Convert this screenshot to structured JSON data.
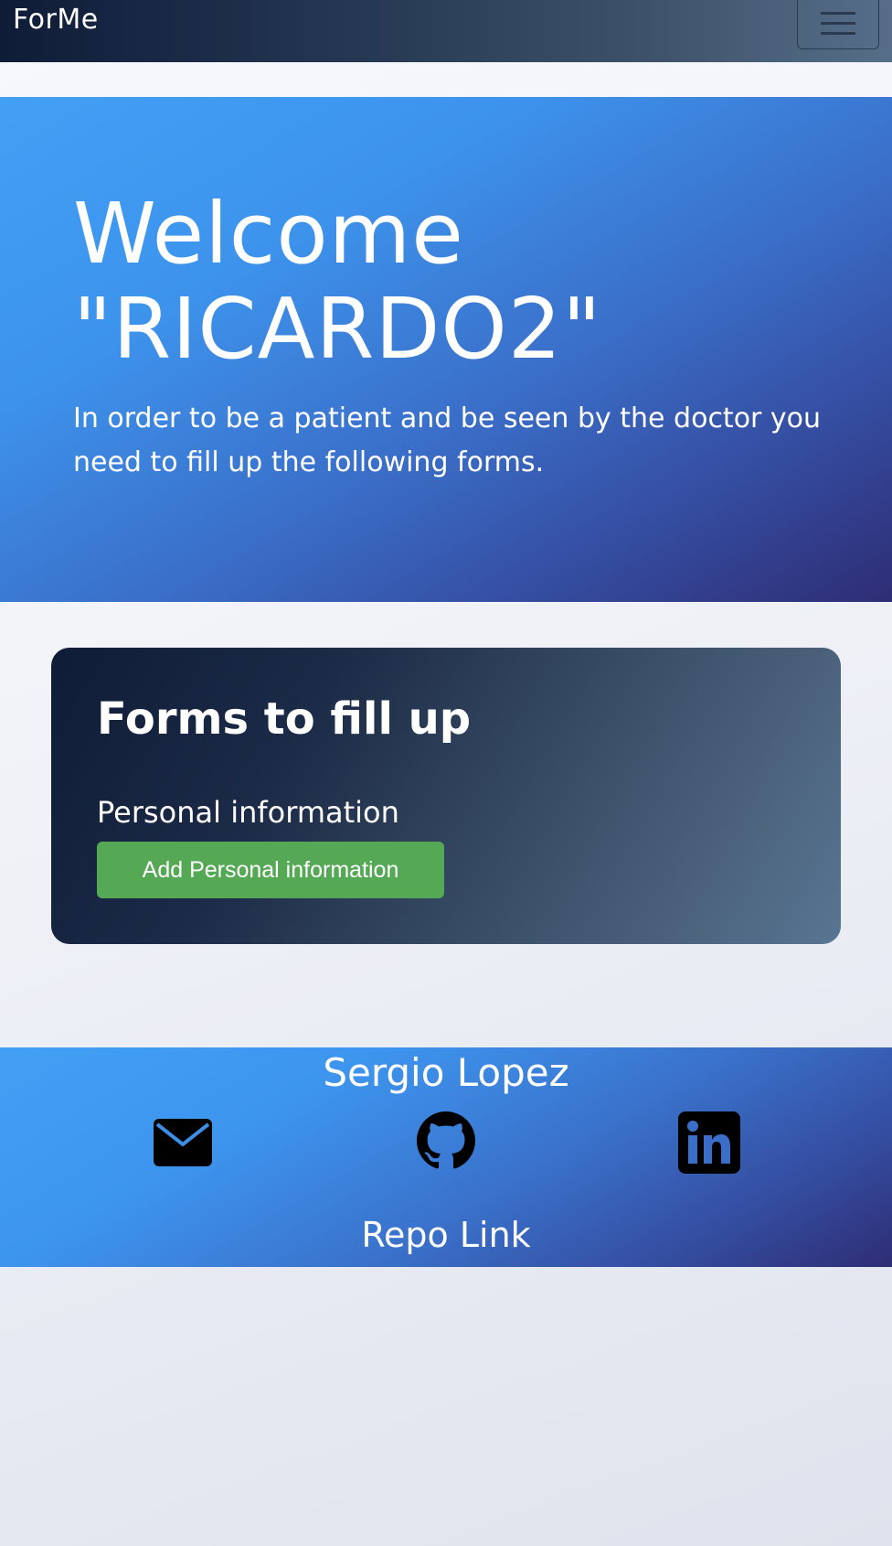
{
  "navbar": {
    "brand": "ForMe",
    "toggle_icon": "hamburger-menu-icon"
  },
  "hero": {
    "title": "Welcome \"RICARDO2\"",
    "text": "In order to be a patient and be seen by the doctor you need to fill up the following forms."
  },
  "forms_card": {
    "title": "Forms to fill up",
    "section_label": "Personal information",
    "add_button_label": "Add Personal information"
  },
  "footer": {
    "name": "Sergio Lopez",
    "icons": [
      "mail-icon",
      "github-icon",
      "linkedin-icon"
    ],
    "repo_link": "Repo Link"
  },
  "colors": {
    "navbar_dark": "#0f1c38",
    "hero_light_blue": "#42a0f4",
    "hero_dark_indigo": "#2e2d74",
    "button_green": "#55a854"
  }
}
